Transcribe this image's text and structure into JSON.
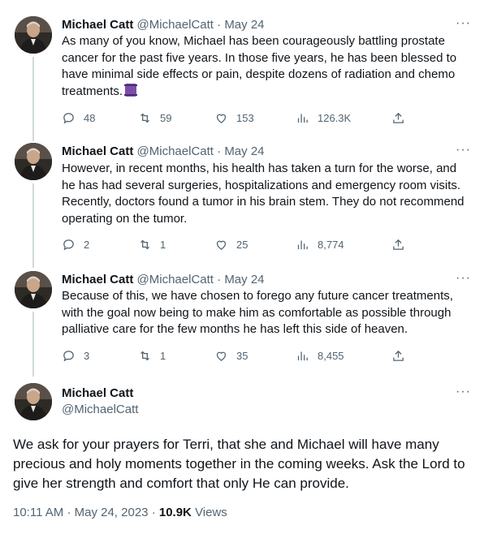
{
  "author": {
    "name": "Michael Catt",
    "handle": "@MichaelCatt"
  },
  "tweets": [
    {
      "date": "May 24",
      "text": "As many of you know, Michael has been courageously battling prostate cancer for the past five years. In those five years, he has been blessed to have minimal side effects or pain, despite dozens of radiation and chemo treatments.",
      "replies": "48",
      "retweets": "59",
      "likes": "153",
      "views": "126.3K"
    },
    {
      "date": "May 24",
      "text": "However, in recent months, his health has taken a turn for the worse, and he has had several surgeries, hospitalizations and emergency room visits. Recently, doctors found a tumor in his brain stem. They do not recommend operating on the tumor.",
      "replies": "2",
      "retweets": "1",
      "likes": "25",
      "views": "8,774"
    },
    {
      "date": "May 24",
      "text": "Because of this, we have chosen to forego any future cancer treatments, with the goal now being to make him as comfortable as possible through palliative care for the few months he has left this side of heaven.",
      "replies": "3",
      "retweets": "1",
      "likes": "35",
      "views": "8,455"
    }
  ],
  "main_tweet": {
    "text": "We ask for your prayers for Terri, that she and Michael will have many precious and holy moments together in the coming weeks. Ask the Lord to give her strength and comfort that only He can provide.",
    "time": "10:11 AM",
    "date": "May 24, 2023",
    "views_count": "10.9K",
    "views_label": "Views"
  },
  "separators": {
    "dot": "·",
    "more": "···"
  },
  "icons": {
    "reply": "reply-icon",
    "retweet": "retweet-icon",
    "like": "heart-icon",
    "views": "views-chart-icon",
    "share": "share-icon",
    "emoji": "purple-ribbon-emoji"
  }
}
